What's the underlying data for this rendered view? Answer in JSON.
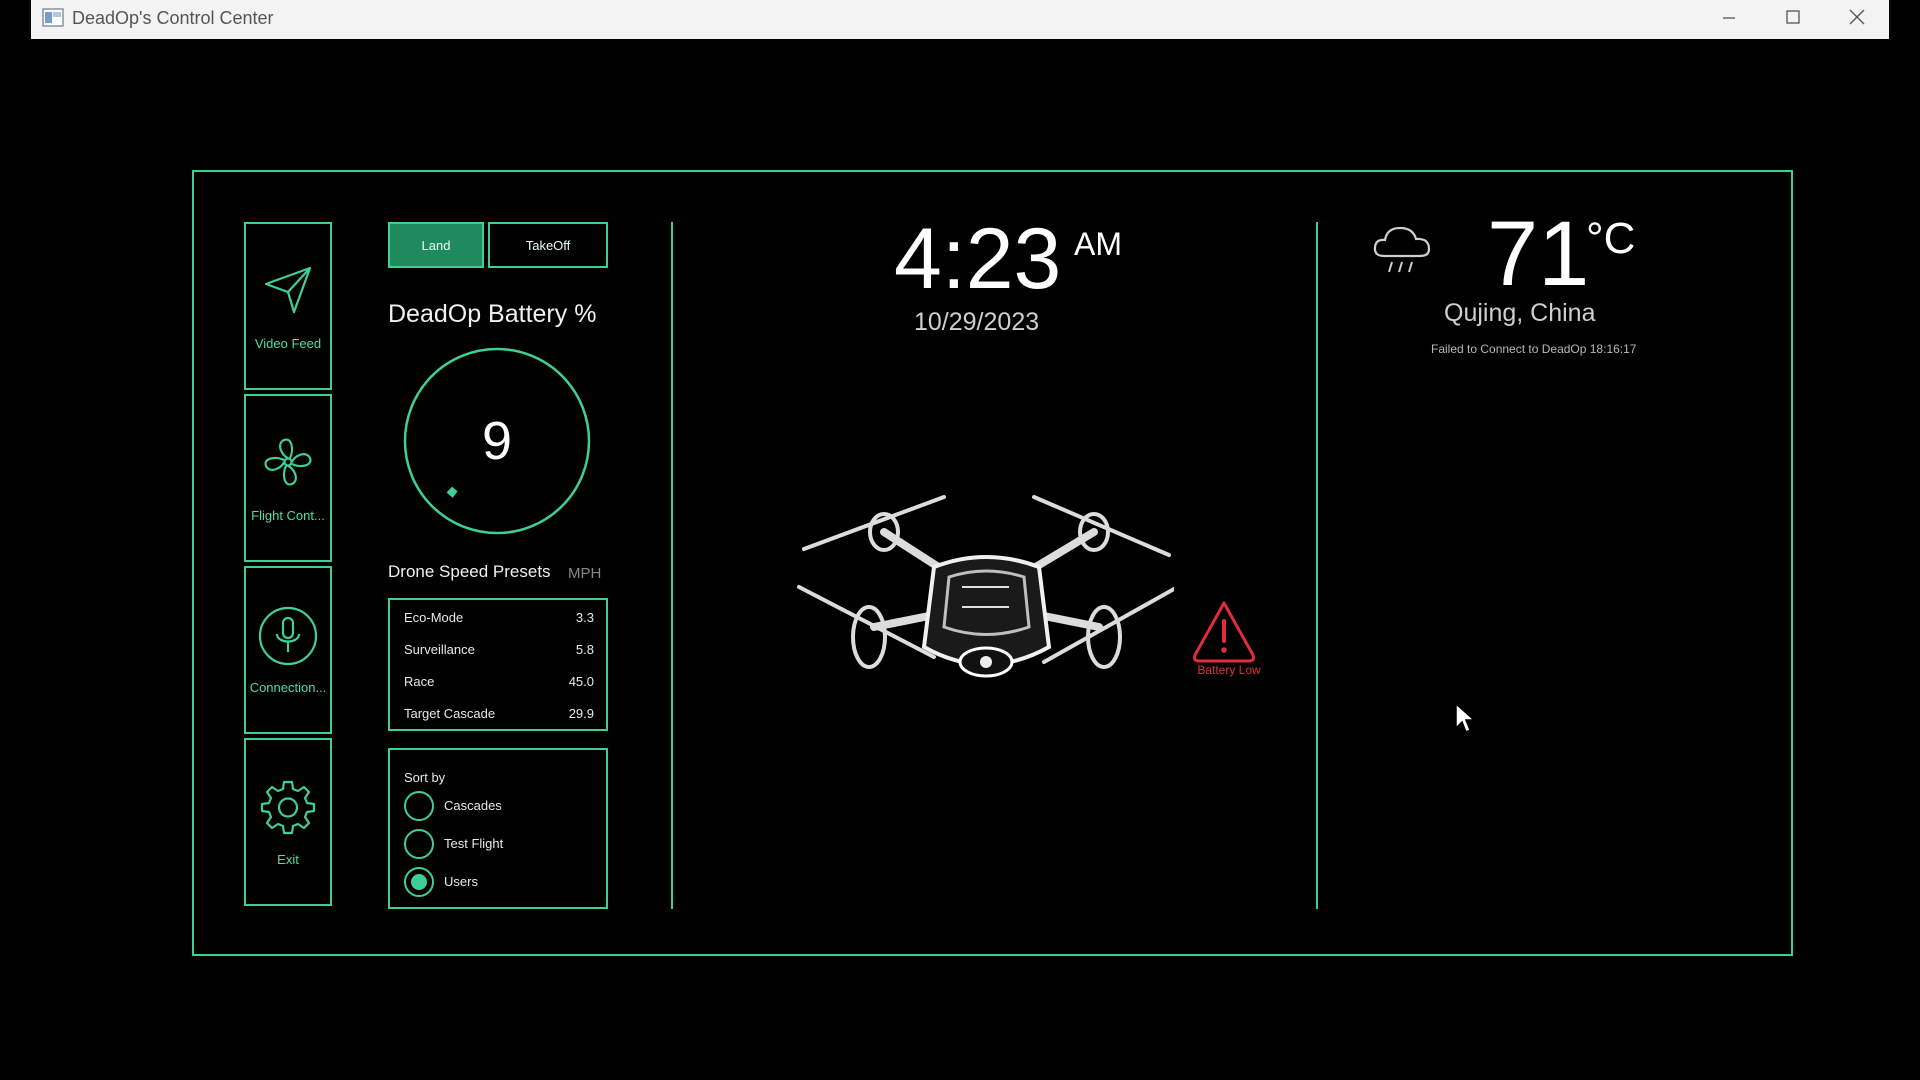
{
  "window": {
    "title": "DeadOp's Control Center"
  },
  "sidebar": {
    "items": [
      {
        "label": "Video Feed",
        "icon": "paper-plane-icon"
      },
      {
        "label": "Flight Cont...",
        "icon": "fan-icon"
      },
      {
        "label": "Connection...",
        "icon": "microphone-icon"
      },
      {
        "label": "Exit",
        "icon": "gear-icon"
      }
    ]
  },
  "controls": {
    "land_label": "Land",
    "takeoff_label": "TakeOff"
  },
  "battery": {
    "title": "DeadOp Battery %",
    "value": "9",
    "level_percent": 9
  },
  "presets": {
    "title": "Drone Speed Presets",
    "unit": "MPH",
    "rows": [
      {
        "name": "Eco-Mode",
        "value": "3.3"
      },
      {
        "name": "Surveillance",
        "value": "5.8"
      },
      {
        "name": "Race",
        "value": "45.0"
      },
      {
        "name": "Target Cascade",
        "value": "29.9"
      }
    ]
  },
  "sort": {
    "title": "Sort by",
    "options": [
      {
        "label": "Cascades",
        "checked": false
      },
      {
        "label": "Test Flight",
        "checked": false
      },
      {
        "label": "Users",
        "checked": true
      }
    ]
  },
  "clock": {
    "time": "4:23",
    "ampm": "AM",
    "date": "10/29/2023"
  },
  "alert": {
    "label": "Battery Low",
    "icon": "warning-triangle-icon",
    "color": "#e02c3c"
  },
  "weather": {
    "icon": "rain-cloud-icon",
    "temperature": "71",
    "unit": "°C",
    "location": "Qujing, China",
    "status": "Failed to Connect to DeadOp   18:16:17"
  },
  "theme": {
    "accent": "#3fcf95",
    "accent_fill": "#1e8a5e",
    "background": "#000000"
  }
}
